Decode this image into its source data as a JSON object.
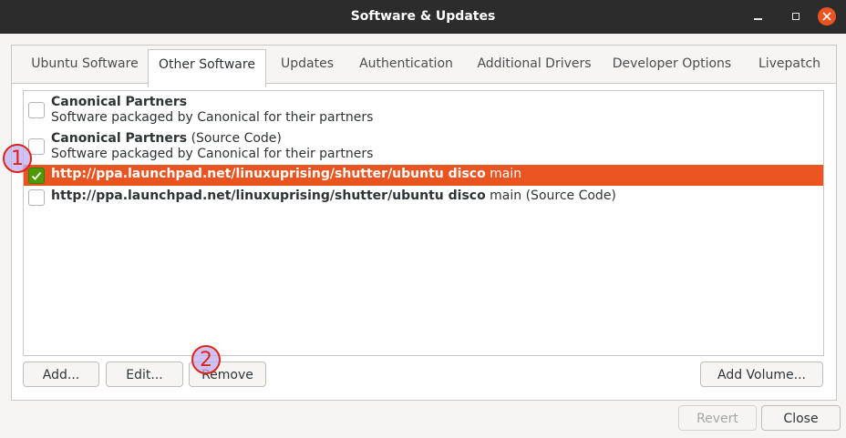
{
  "window": {
    "title": "Software & Updates"
  },
  "tabs": [
    {
      "label": "Ubuntu Software",
      "active": false
    },
    {
      "label": "Other Software",
      "active": true
    },
    {
      "label": "Updates",
      "active": false
    },
    {
      "label": "Authentication",
      "active": false
    },
    {
      "label": "Additional Drivers",
      "active": false
    },
    {
      "label": "Developer Options",
      "active": false
    },
    {
      "label": "Livepatch",
      "active": false
    }
  ],
  "sources": [
    {
      "name": "Canonical Partners",
      "suffix": "",
      "description": "Software packaged by Canonical for their partners",
      "checked": false,
      "selected": false
    },
    {
      "name": "Canonical Partners",
      "suffix": " (Source Code)",
      "description": "Software packaged by Canonical for their partners",
      "checked": false,
      "selected": false
    },
    {
      "name": "http://ppa.launchpad.net/linuxuprising/shutter/ubuntu disco",
      "suffix": " main",
      "description": "",
      "checked": true,
      "selected": true
    },
    {
      "name": "http://ppa.launchpad.net/linuxuprising/shutter/ubuntu disco",
      "suffix": " main (Source Code)",
      "description": "",
      "checked": false,
      "selected": false
    }
  ],
  "buttons": {
    "add": "Add...",
    "edit": "Edit...",
    "remove": "Remove",
    "add_volume": "Add Volume...",
    "revert": "Revert",
    "close": "Close"
  },
  "annotations": {
    "marker1": "1",
    "marker2": "2"
  },
  "colors": {
    "accent": "#e95420",
    "check": "#4e9a06",
    "titlebar": "#2c2c2c",
    "marker_border": "#e0231a"
  }
}
